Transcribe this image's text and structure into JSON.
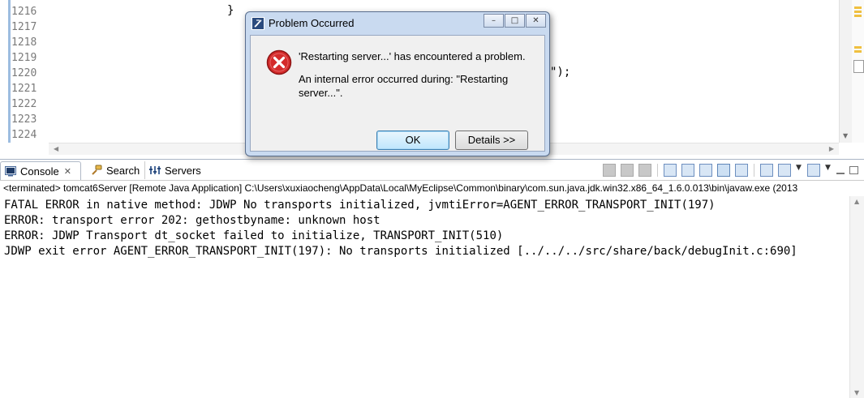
{
  "editor": {
    "line_numbers": [
      "1216",
      "1217",
      "1218",
      "1219",
      "1220",
      "1221",
      "1222",
      "1223",
      "1224"
    ],
    "code_brace": "}",
    "code_tail": "\");"
  },
  "console": {
    "tabs": [
      {
        "label": "Console",
        "active": true
      },
      {
        "label": "Search",
        "active": false
      },
      {
        "label": "Servers",
        "active": false
      }
    ],
    "status_line": "<terminated> tomcat6Server [Remote Java Application] C:\\Users\\xuxiaocheng\\AppData\\Local\\MyEclipse\\Common\\binary\\com.sun.java.jdk.win32.x86_64_1.6.0.013\\bin\\javaw.exe (2013",
    "lines": [
      "FATAL ERROR in native method: JDWP No transports initialized, jvmtiError=AGENT_ERROR_TRANSPORT_INIT(197)",
      "ERROR: transport error 202: gethostbyname: unknown host",
      "ERROR: JDWP Transport dt_socket failed to initialize, TRANSPORT_INIT(510)",
      "JDWP exit error AGENT_ERROR_TRANSPORT_INIT(197): No transports initialized [../../../src/share/back/debugInit.c:690]"
    ]
  },
  "dialog": {
    "title": "Problem Occurred",
    "message": "'Restarting server...' has encountered a problem.",
    "detail": "An internal error occurred during: \"Restarting server...\".",
    "ok_label": "OK",
    "details_label": "Details >>"
  },
  "icons": {
    "dialog_app": "myeclipse-icon",
    "error": "error-icon",
    "console": "console-icon",
    "search": "search-icon",
    "servers": "servers-icon"
  },
  "colors": {
    "error_red": "#d42b2b",
    "dialog_frame": "#c9daf0",
    "line_number": "#7a7a7a"
  }
}
